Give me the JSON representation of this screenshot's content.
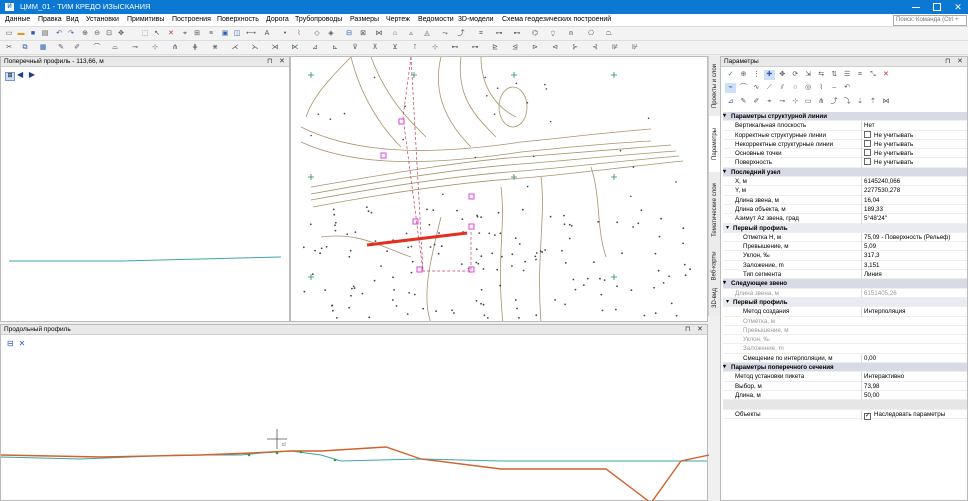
{
  "window": {
    "title": "ЦММ_01 - ТИМ КРЕДО ИЗЫСКАНИЯ",
    "app_icon": "И"
  },
  "menu": [
    "Данные",
    "Правка",
    "Вид",
    "Установки",
    "Примитивы",
    "Построения",
    "Поверхность",
    "Дорога",
    "Трубопроводы",
    "Размеры",
    "Чертеж",
    "Ведомости",
    "3D-модели",
    "Схема геодезических построений"
  ],
  "command_search": {
    "placeholder": "Поиск: Команда (Ctrl + "
  },
  "cross_profile": {
    "title": "Поперечный профиль - 113,66, м"
  },
  "long_profile": {
    "title": "Продольный профиль",
    "cursor_label": "cl"
  },
  "side_tabs": [
    "Проекты и слои",
    "Параметры",
    "Тематические слои",
    "Веб-карты",
    "3D-вид"
  ],
  "params": {
    "title": "Параметры",
    "rows": [
      {
        "type": "hdr",
        "k": "Параметры структурной линии"
      },
      {
        "type": "row",
        "k": "Вертикальная плоскость",
        "v": "Нет"
      },
      {
        "type": "row",
        "k": "Корректные структурные линии",
        "v": "Не учитывать",
        "cb": true
      },
      {
        "type": "row",
        "k": "Некорректные структурные линии",
        "v": "Не учитывать",
        "cb": true
      },
      {
        "type": "row",
        "k": "Основные точки",
        "v": "Не учитывать",
        "cb": true
      },
      {
        "type": "row",
        "k": "Поверхность",
        "v": "Не учитывать",
        "cb": true
      },
      {
        "type": "hdr",
        "k": "Последний узел"
      },
      {
        "type": "row",
        "k": "X, м",
        "v": "6145240,066"
      },
      {
        "type": "row",
        "k": "Y, м",
        "v": "2277530,278"
      },
      {
        "type": "row",
        "k": "Длина звена, м",
        "v": "16,04"
      },
      {
        "type": "row",
        "k": "Длина объекта, м",
        "v": "189,33"
      },
      {
        "type": "row",
        "k": "Азимут Аz звена, град",
        "v": "5°48'24\""
      },
      {
        "type": "sub",
        "k": "Первый профиль"
      },
      {
        "type": "row",
        "ind": true,
        "k": "Отметка Н, м",
        "v": "75,09 - Поверхность (Рельеф)"
      },
      {
        "type": "row",
        "ind": true,
        "k": "Превышение, м",
        "v": "5,09"
      },
      {
        "type": "row",
        "ind": true,
        "k": "Уклон, ‰",
        "v": "317,3"
      },
      {
        "type": "row",
        "ind": true,
        "k": "Заложение, m",
        "v": "3,151"
      },
      {
        "type": "row",
        "ind": true,
        "k": "Тип сегмента",
        "v": "Линия"
      },
      {
        "type": "hdr",
        "k": "Следующее звено"
      },
      {
        "type": "row",
        "dim": true,
        "k": "Длина звена, м",
        "v": "6151405,26"
      },
      {
        "type": "sub",
        "k": "Первый профиль"
      },
      {
        "type": "row",
        "ind": true,
        "k": "Метод создания",
        "v": "Интерполяция"
      },
      {
        "type": "row",
        "ind": true,
        "dim": true,
        "k": "Отметка, м",
        "v": ""
      },
      {
        "type": "row",
        "ind": true,
        "dim": true,
        "k": "Превышение, м",
        "v": ""
      },
      {
        "type": "row",
        "ind": true,
        "dim": true,
        "k": "Уклон, ‰",
        "v": ""
      },
      {
        "type": "row",
        "ind": true,
        "dim": true,
        "k": "Заложение, m",
        "v": ""
      },
      {
        "type": "row",
        "ind": true,
        "k": "Смещение по интерполяции, м",
        "v": "0,00"
      },
      {
        "type": "hdr",
        "k": "Параметры поперечного сечения"
      },
      {
        "type": "row",
        "k": "Метод установки пикета",
        "v": "Интерактивно"
      },
      {
        "type": "row",
        "k": "Выбор, м",
        "v": "73,98"
      },
      {
        "type": "row",
        "k": "Длина, м",
        "v": "50,00"
      },
      {
        "type": "sel",
        "k": "",
        "v": ""
      },
      {
        "type": "row",
        "k": "Объекты",
        "v": "Наследовать параметры",
        "cb": true,
        "checked": true
      }
    ]
  },
  "colors": {
    "titlebar": "#0b78d4",
    "contour": "#a8926c",
    "profile_line": "#d0622c",
    "ground_line": "#3fa3a8",
    "selected_line": "#e03020",
    "marker": "#e040e0"
  }
}
